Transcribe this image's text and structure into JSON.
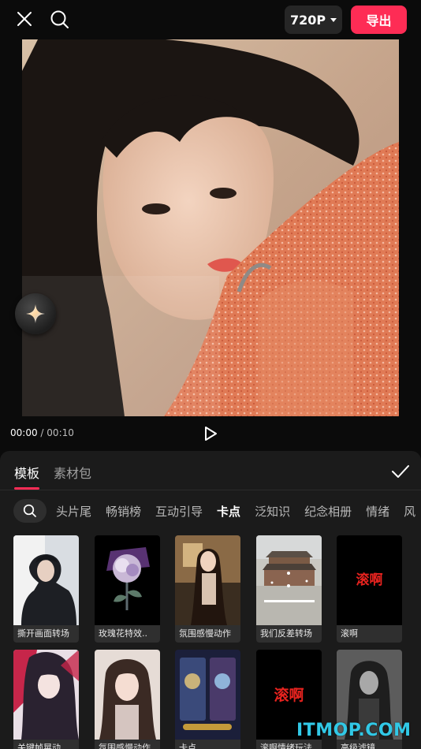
{
  "header": {
    "resolution": "720P",
    "export_label": "导出"
  },
  "playback": {
    "current": "00:00",
    "separator": "/",
    "total": "00:10"
  },
  "panel": {
    "tabs": [
      {
        "label": "模板",
        "active": true
      },
      {
        "label": "素材包",
        "active": false
      }
    ],
    "categories": [
      {
        "label": "头片尾",
        "active": false
      },
      {
        "label": "畅销榜",
        "active": false
      },
      {
        "label": "互动引导",
        "active": false
      },
      {
        "label": "卡点",
        "active": true
      },
      {
        "label": "泛知识",
        "active": false
      },
      {
        "label": "纪念相册",
        "active": false
      },
      {
        "label": "情绪",
        "active": false
      },
      {
        "label": "风",
        "active": false
      }
    ],
    "templates": [
      {
        "label": "撕开画面转场"
      },
      {
        "label": "玫瑰花特效.."
      },
      {
        "label": "氛围感慢动作"
      },
      {
        "label": "我们反差转场"
      },
      {
        "label": "滚啊",
        "thumb_text": "滚啊"
      },
      {
        "label": "关键帧晃动.."
      },
      {
        "label": "氛围感慢动作"
      },
      {
        "label": "卡点"
      },
      {
        "label": "滚啊情绪玩法",
        "thumb_text": "滚啊"
      },
      {
        "label": "高级滤镜"
      }
    ]
  },
  "watermark": "ITMOP.COM",
  "colors": {
    "accent": "#fe2c55",
    "panel_bg": "#1b1b1b",
    "watermark": "#31c8e6"
  }
}
